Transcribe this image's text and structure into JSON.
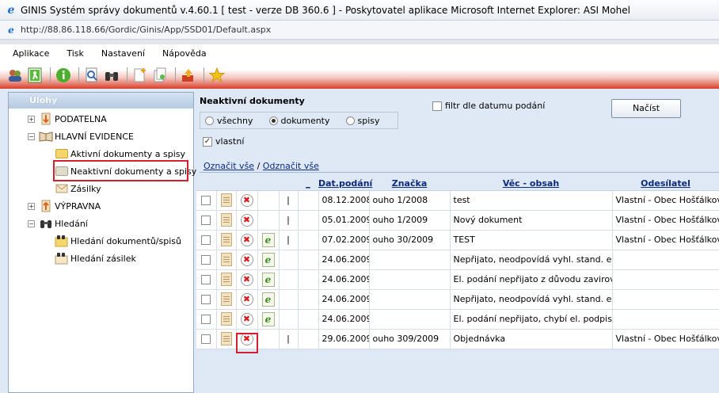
{
  "window": {
    "title": "GINIS Systém správy dokumentů v.4.60.1 [ test - verze DB 360.6 ] - Poskytovatel aplikace Microsoft Internet Explorer: ASI Mohel",
    "url": "http://88.86.118.66/Gordic/Ginis/App/SSD01/Default.aspx"
  },
  "menu": [
    "Aplikace",
    "Tisk",
    "Nastavení",
    "Nápověda"
  ],
  "toolbar_icons": [
    "users-icon",
    "exit-icon",
    "info-icon",
    "search-doc-icon",
    "binoculars-icon",
    "new-doc-icon",
    "copy-doc-icon",
    "upload-icon",
    "star-icon"
  ],
  "sidebar": {
    "heading": "Úlohy",
    "items": [
      {
        "label": "PODATELNA",
        "expander": "+"
      },
      {
        "label": "HLAVNÍ EVIDENCE",
        "expander": "−"
      },
      {
        "label": "Aktivní dokumenty a spisy"
      },
      {
        "label": "Neaktivní dokumenty a spisy"
      },
      {
        "label": "Zásilky"
      },
      {
        "label": "VÝPRAVNA",
        "expander": "+"
      },
      {
        "label": "Hledání",
        "expander": "−"
      },
      {
        "label": "Hledání dokumentů/spisů"
      },
      {
        "label": "Hledání zásilek"
      }
    ]
  },
  "main": {
    "title": "Neaktivní dokumenty",
    "radios": [
      {
        "label": "všechny",
        "selected": false
      },
      {
        "label": "dokumenty",
        "selected": true
      },
      {
        "label": "spisy",
        "selected": false
      }
    ],
    "checkbox_vlastni": {
      "label": "vlastní",
      "checked": true
    },
    "checkbox_filtr": {
      "label": "filtr dle datumu podání",
      "checked": false
    },
    "load_button": "Načíst",
    "select_all": "Označit vše",
    "separator": "/",
    "deselect_all": "Odznačit vše"
  },
  "table": {
    "headers": [
      "_",
      "Dat.podání",
      "Značka",
      "Věc - obsah",
      "Odesílatel"
    ],
    "rows": [
      {
        "e": false,
        "flag": "|",
        "date": "08.12.2008",
        "mark": "ouho 1/2008",
        "subject": "test",
        "sender": "Vlastní - Obec Hošťálkovy"
      },
      {
        "e": false,
        "flag": "|",
        "date": "05.01.2009",
        "mark": "ouho 1/2009",
        "subject": "Nový dokument",
        "sender": "Vlastní - Obec Hošťálkovy"
      },
      {
        "e": true,
        "flag": "|",
        "date": "07.02.2009",
        "mark": "ouho 30/2009",
        "subject": "TEST",
        "sender": "Vlastní - Obec Hošťálkovy"
      },
      {
        "e": true,
        "flag": "",
        "date": "24.06.2009",
        "mark": "",
        "subject": "Nepřijato, neodpovídá vyhl. stand. el. pod",
        "sender": ""
      },
      {
        "e": true,
        "flag": "",
        "date": "24.06.2009",
        "mark": "",
        "subject": "El. podání nepřijato z důvodu zavirování.",
        "sender": ""
      },
      {
        "e": true,
        "flag": "",
        "date": "24.06.2009",
        "mark": "",
        "subject": "Nepřijato, neodpovídá vyhl. stand. el. pod",
        "sender": ""
      },
      {
        "e": true,
        "flag": "",
        "date": "24.06.2009",
        "mark": "",
        "subject": "El. podání nepřijato, chybí el. podpis.",
        "sender": ""
      },
      {
        "e": false,
        "flag": "|",
        "date": "29.06.2009",
        "mark": "ouho 309/2009",
        "subject": "Objednávka",
        "sender": "Vlastní - Obec Hošťálkovy"
      }
    ]
  },
  "colors": {
    "highlight": "#d2202e",
    "toolbar_red": "#d9402a",
    "link": "#0a2a80"
  }
}
